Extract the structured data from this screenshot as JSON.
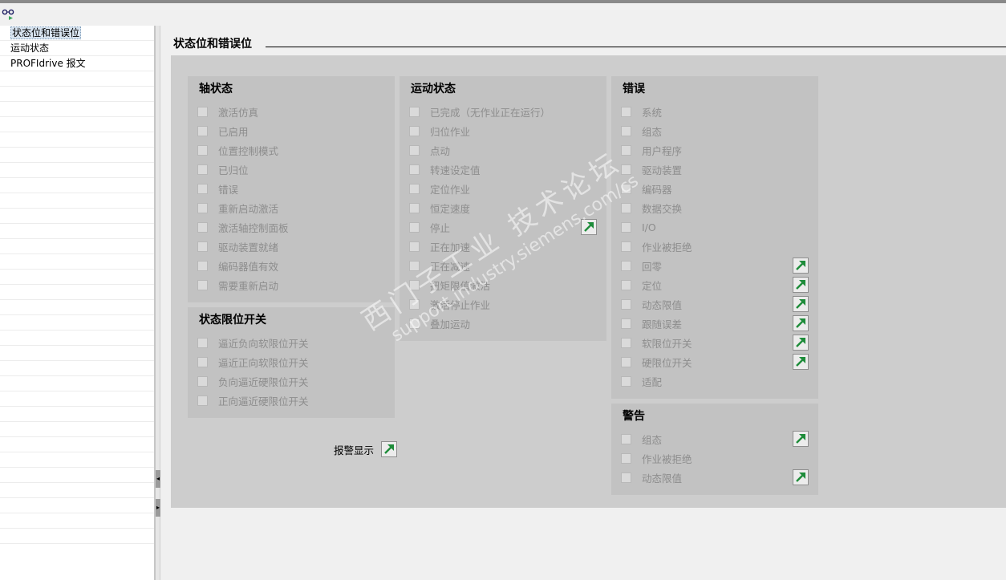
{
  "nav": {
    "items": [
      {
        "label": "状态位和错误位",
        "selected": true
      },
      {
        "label": "运动状态",
        "selected": false
      },
      {
        "label": "PROFIdrive 报文",
        "selected": false
      }
    ]
  },
  "main": {
    "title": "状态位和错误位",
    "alarm_label": "报警显示"
  },
  "groups": {
    "axis_status": {
      "title": "轴状态",
      "items": [
        "激活仿真",
        "已启用",
        "位置控制模式",
        "已归位",
        "错误",
        "重新启动激活",
        "激活轴控制面板",
        "驱动装置就绪",
        "编码器值有效",
        "需要重新启动"
      ]
    },
    "limit_switch": {
      "title": "状态限位开关",
      "items": [
        "逼近负向软限位开关",
        "逼近正向软限位开关",
        "负向逼近硬限位开关",
        "正向逼近硬限位开关"
      ]
    },
    "motion_status": {
      "title": "运动状态",
      "items": [
        "已完成（无作业正在运行）",
        "归位作业",
        "点动",
        "转速设定值",
        "定位作业",
        "恒定速度",
        "停止",
        "正在加速",
        "正在减速",
        "扭矩限值激活",
        "激活停止作业",
        "叠加运动"
      ]
    },
    "errors": {
      "title": "错误",
      "items": [
        "系统",
        "组态",
        "用户程序",
        "驱动装置",
        "编码器",
        "数据交换",
        "I/O",
        "作业被拒绝",
        "回零",
        "定位",
        "动态限值",
        "跟随误差",
        "软限位开关",
        "硬限位开关",
        "适配"
      ]
    },
    "warnings": {
      "title": "警告",
      "items": [
        "组态",
        "作业被拒绝",
        "动态限值"
      ]
    }
  },
  "watermark": {
    "line1": "西门子工业 技术论坛",
    "line2": "support.industry.siemens.com/cs"
  },
  "colors": {
    "panel": "#cdcdcd",
    "group": "#c2c2c2",
    "disabled_text": "#8d8d8d",
    "jump_arrow": "#1e8c3a"
  },
  "icons": {
    "toolbar": "monitor-glasses-icon",
    "jump": "jump-arrow-icon"
  }
}
